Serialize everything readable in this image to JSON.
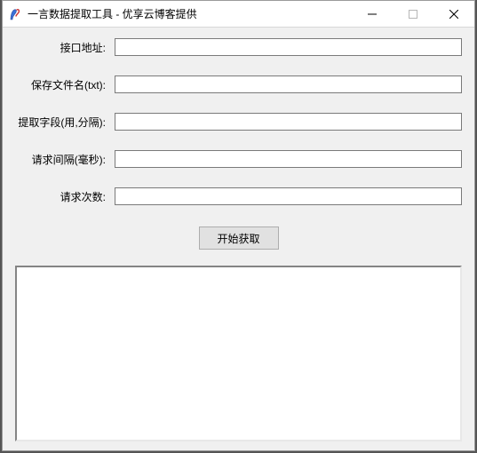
{
  "window": {
    "title": "一言数据提取工具 - 优享云博客提供"
  },
  "form": {
    "api_url": {
      "label": "接口地址:",
      "value": ""
    },
    "save_name": {
      "label": "保存文件名(txt):",
      "value": ""
    },
    "fields": {
      "label": "提取字段(用,分隔):",
      "value": ""
    },
    "interval": {
      "label": "请求间隔(毫秒):",
      "value": ""
    },
    "count": {
      "label": "请求次数:",
      "value": ""
    }
  },
  "actions": {
    "start_label": "开始获取"
  },
  "output": {
    "text": ""
  }
}
